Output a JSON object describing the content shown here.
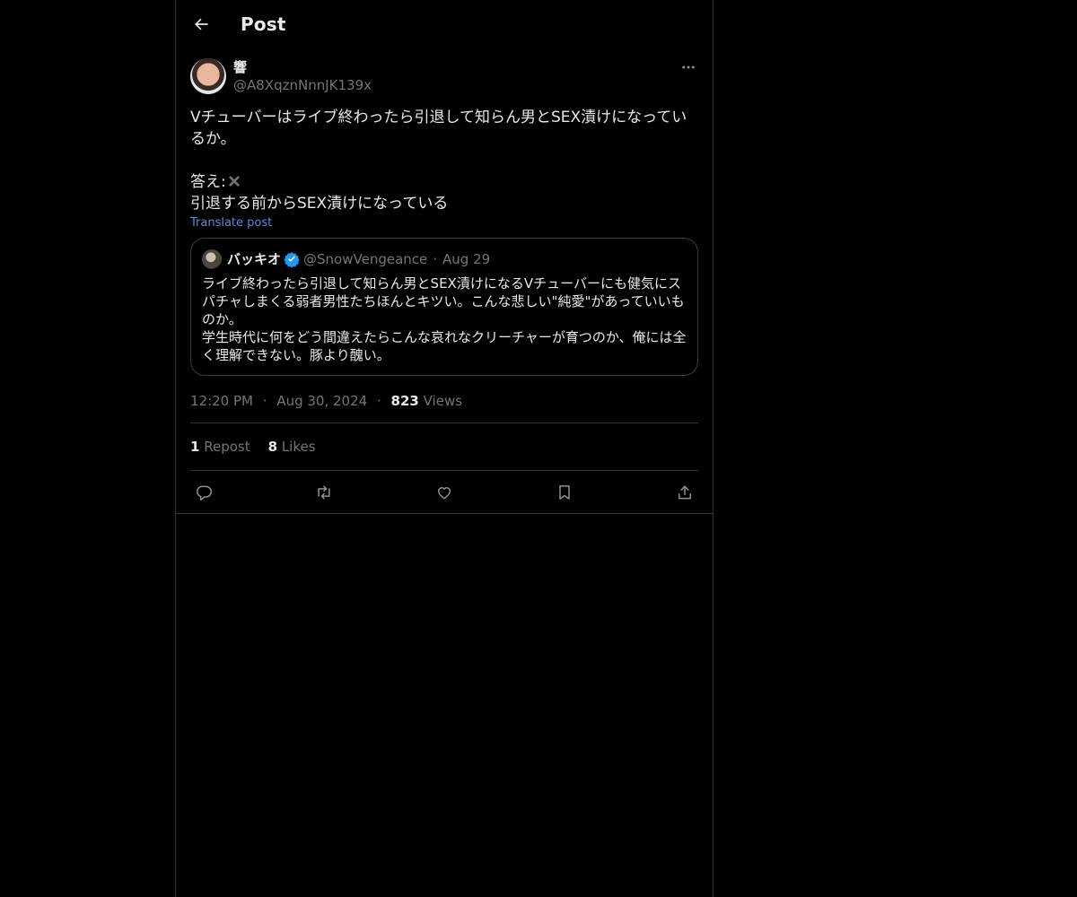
{
  "header": {
    "title": "Post"
  },
  "post": {
    "author": {
      "display_name": "響",
      "handle": "@A8XqznNnnJK139x"
    },
    "text_line1": "Vチューバーはライブ終わったら引退して知らん男とSEX漬けになっているか。",
    "answer_prefix": "答え:",
    "text_line3": "引退する前からSEX漬けになっている",
    "translate_label": "Translate post",
    "quote": {
      "display_name": "バッキオ",
      "handle": "@SnowVengeance",
      "separator": "·",
      "date": "Aug 29",
      "text": "ライブ終わったら引退して知らん男とSEX漬けになるVチューバーにも健気にスパチャしまくる弱者男性たちほんとキツい。こんな悲しい\"純愛\"があっていいものか。\n学生時代に何をどう間違えたらこんな哀れなクリーチャーが育つのか、俺には全く理解できない。豚より醜い。"
    },
    "meta": {
      "time": "12:20 PM",
      "date": "Aug 30, 2024",
      "separator": "·",
      "views_count": "823",
      "views_label": "Views"
    },
    "stats": {
      "reposts_count": "1",
      "reposts_label": "Repost",
      "likes_count": "8",
      "likes_label": "Likes"
    }
  },
  "colors": {
    "background": "#000000",
    "text": "#e7e9ea",
    "muted": "#71767b",
    "link": "#4b8fe6",
    "verified": "#1d9bf0",
    "border": "#2f3336"
  },
  "icons": [
    "back-arrow-icon",
    "more-icon",
    "cross-mark-icon",
    "verified-badge-icon",
    "reply-icon",
    "repost-icon",
    "like-icon",
    "bookmark-icon",
    "share-icon"
  ]
}
